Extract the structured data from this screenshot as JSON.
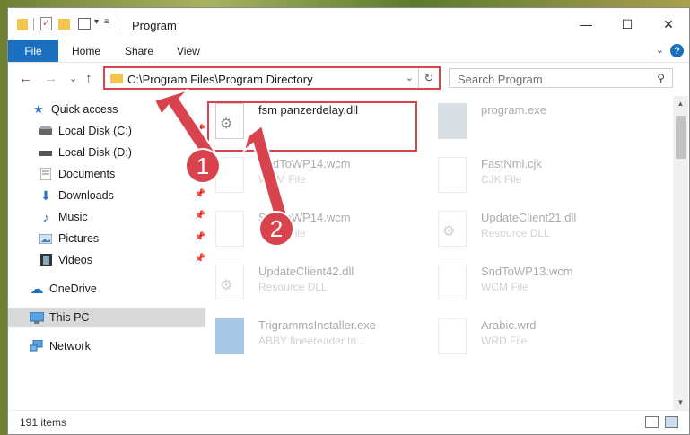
{
  "window": {
    "title": "Program",
    "minimize": "—",
    "maximize": "☐",
    "close": "✕"
  },
  "ribbon": {
    "file": "File",
    "tabs": [
      "Home",
      "Share",
      "View"
    ],
    "expand": "⌄",
    "help": "?"
  },
  "nav": {
    "back": "←",
    "forward": "→",
    "recent": "⌄",
    "up": "↑",
    "address": "C:\\Program Files\\Program Directory",
    "address_dropdown": "⌄",
    "refresh": "↻",
    "search_placeholder": "Search Program",
    "search_icon": "⚲"
  },
  "sidebar": {
    "items": [
      {
        "label": "Quick access",
        "icon": "star-icon"
      },
      {
        "label": "Local Disk (C:)",
        "icon": "drive-icon",
        "pinned": true
      },
      {
        "label": "Local Disk (D:)",
        "icon": "drive-icon",
        "pinned": true
      },
      {
        "label": "Documents",
        "icon": "documents-icon",
        "pinned": true
      },
      {
        "label": "Downloads",
        "icon": "downloads-icon",
        "pinned": true
      },
      {
        "label": "Music",
        "icon": "music-icon",
        "pinned": true
      },
      {
        "label": "Pictures",
        "icon": "pictures-icon",
        "pinned": true
      },
      {
        "label": "Videos",
        "icon": "videos-icon",
        "pinned": true
      },
      {
        "label": "OneDrive",
        "icon": "cloud-icon"
      },
      {
        "label": "This PC",
        "icon": "pc-icon",
        "selected": true
      },
      {
        "label": "Network",
        "icon": "network-icon"
      }
    ]
  },
  "files": [
    {
      "name": "fsm panzerdelay.dll",
      "type": "",
      "highlighted": true
    },
    {
      "name": "program.exe",
      "type": ""
    },
    {
      "name": "SndToWP14.wcm",
      "type": "WCM File"
    },
    {
      "name": "FastNml.cjk",
      "type": "CJK File"
    },
    {
      "name": "SndToWP14.wcm",
      "type": "WCM File"
    },
    {
      "name": "UpdateClient21.dll",
      "type": "Resource DLL"
    },
    {
      "name": "UpdateClient42.dll",
      "type": "Resource DLL"
    },
    {
      "name": "SndToWP13.wcm",
      "type": "WCM File"
    },
    {
      "name": "TrigrammsInstaller.exe",
      "type": "ABBY fineereader tri..."
    },
    {
      "name": "Arabic.wrd",
      "type": "WRD File"
    }
  ],
  "status": {
    "count": "191 items"
  },
  "annotations": {
    "step1": "1",
    "step2": "2"
  },
  "colors": {
    "accent": "#1a6fc1",
    "annotation": "#d9434e"
  }
}
